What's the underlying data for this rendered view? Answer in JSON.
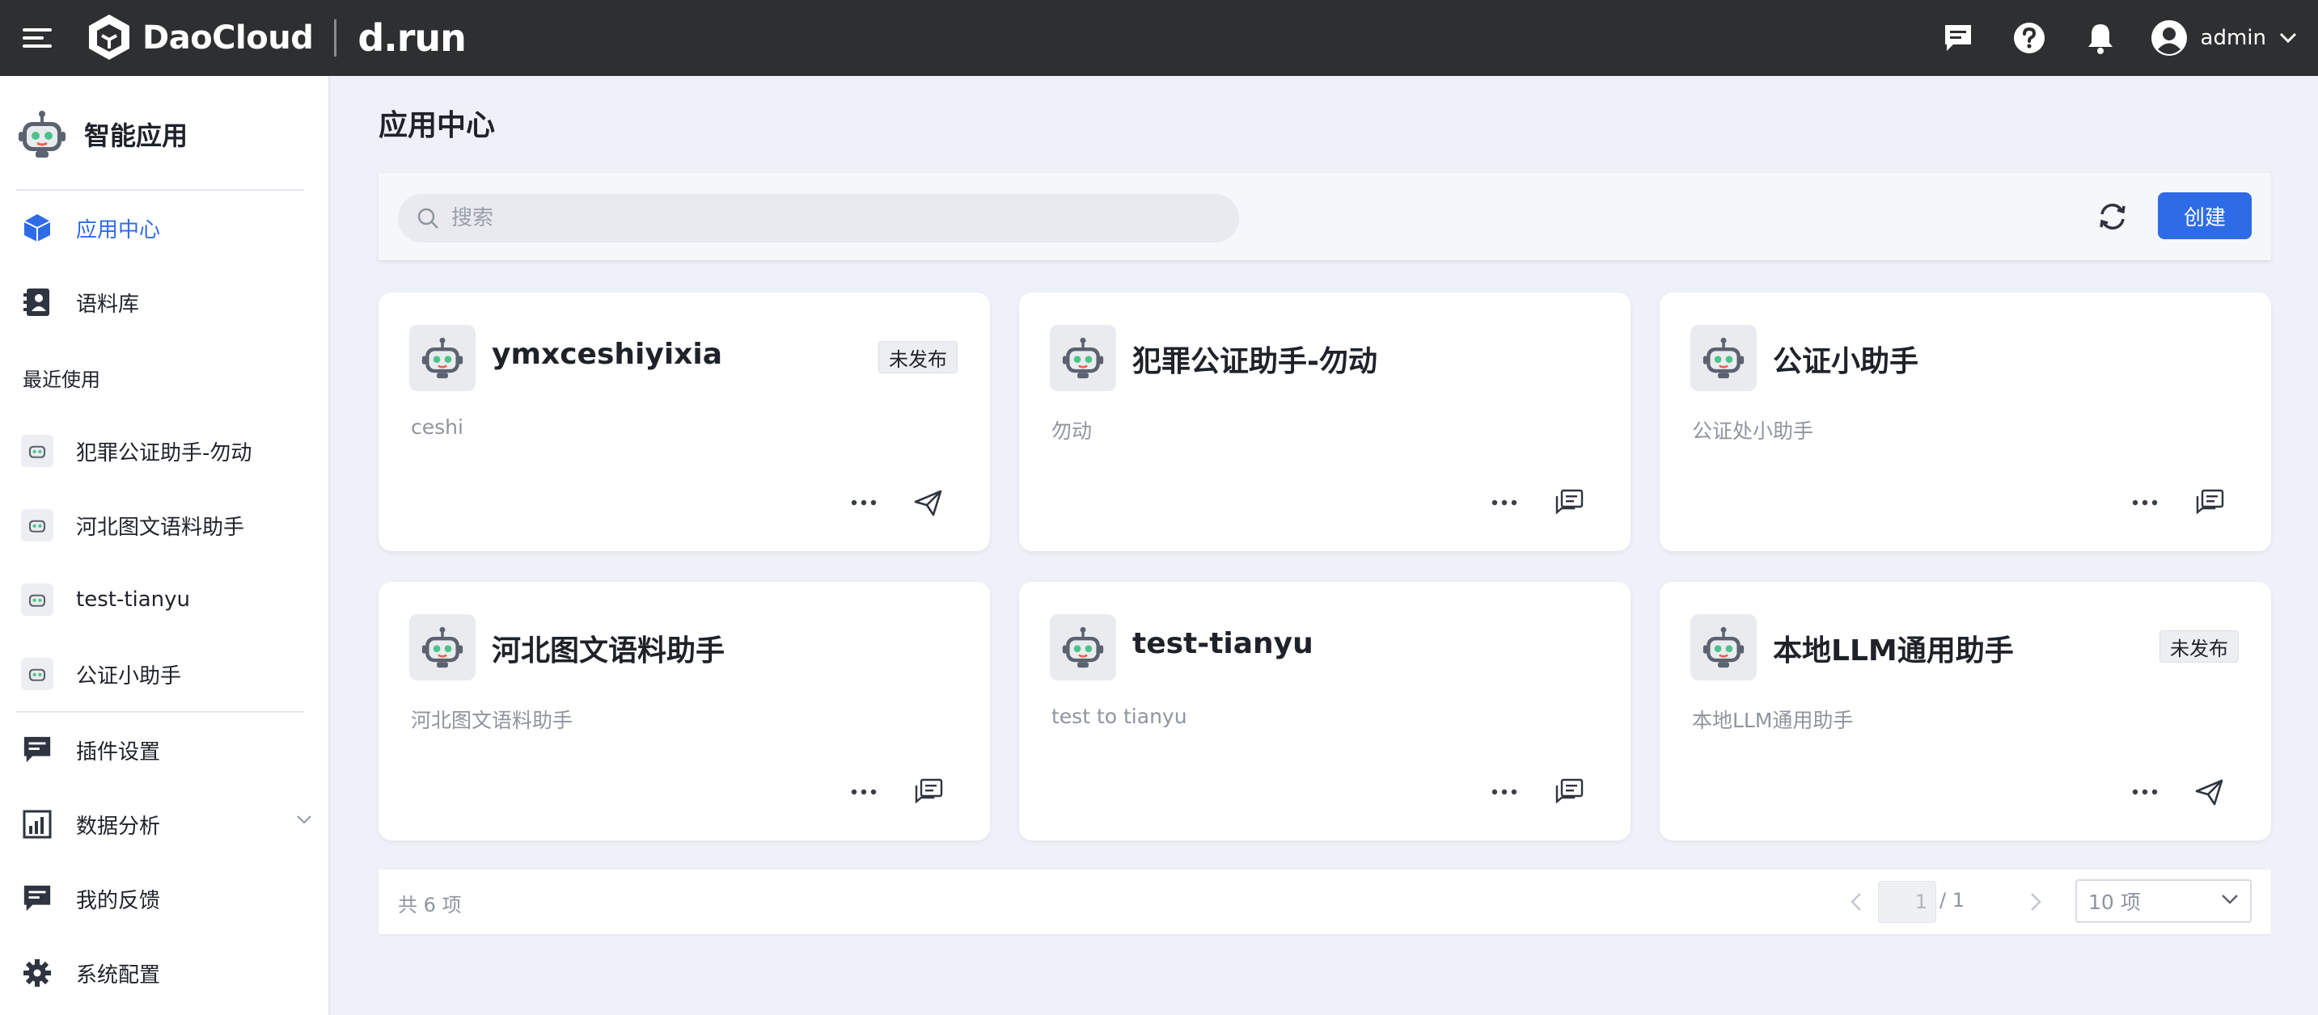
{
  "header": {
    "brand_name": "DaoCloud",
    "brand_product": "d.run",
    "user_name": "admin",
    "icons": [
      "menu-icon",
      "message-icon",
      "help-icon",
      "bell-icon",
      "user-avatar-icon",
      "chevron-down-icon"
    ]
  },
  "sidebar": {
    "title": "智能应用",
    "nav": [
      {
        "label": "应用中心",
        "icon": "cube-icon",
        "active": true
      },
      {
        "label": "语料库",
        "icon": "book-icon",
        "active": false
      }
    ],
    "recent_title": "最近使用",
    "recent": [
      {
        "label": "犯罪公证助手-勿动"
      },
      {
        "label": "河北图文语料助手"
      },
      {
        "label": "test-tianyu"
      },
      {
        "label": "公证小助手"
      }
    ],
    "bottom_nav": [
      {
        "label": "插件设置",
        "icon": "plugin-icon"
      },
      {
        "label": "数据分析",
        "icon": "chart-icon"
      },
      {
        "label": "我的反馈",
        "icon": "feedback-icon"
      },
      {
        "label": "系统配置",
        "icon": "gear-icon"
      }
    ]
  },
  "main": {
    "page_title": "应用中心",
    "search_placeholder": "搜索",
    "search_value": "",
    "create_label": "创建",
    "accent_color": "#2e6be6",
    "cards": [
      {
        "name": "ymxceshiyixia",
        "desc": "ceshi",
        "badge": "未发布",
        "action_icon": "send-icon"
      },
      {
        "name": "犯罪公证助手-勿动",
        "desc": "勿动",
        "badge": "",
        "action_icon": "chat-icon"
      },
      {
        "name": "公证小助手",
        "desc": "公证处小助手",
        "badge": "",
        "action_icon": "chat-icon"
      },
      {
        "name": "河北图文语料助手",
        "desc": "河北图文语料助手",
        "badge": "",
        "action_icon": "chat-icon"
      },
      {
        "name": "test-tianyu",
        "desc": "test to tianyu",
        "badge": "",
        "action_icon": "chat-icon"
      },
      {
        "name": "本地LLM通用助手",
        "desc": "本地LLM通用助手",
        "badge": "未发布",
        "action_icon": "send-icon"
      }
    ]
  },
  "pagination": {
    "total_text": "共 6 项",
    "current_page": "1",
    "page_total_text": "/ 1",
    "page_size": "10 项"
  }
}
